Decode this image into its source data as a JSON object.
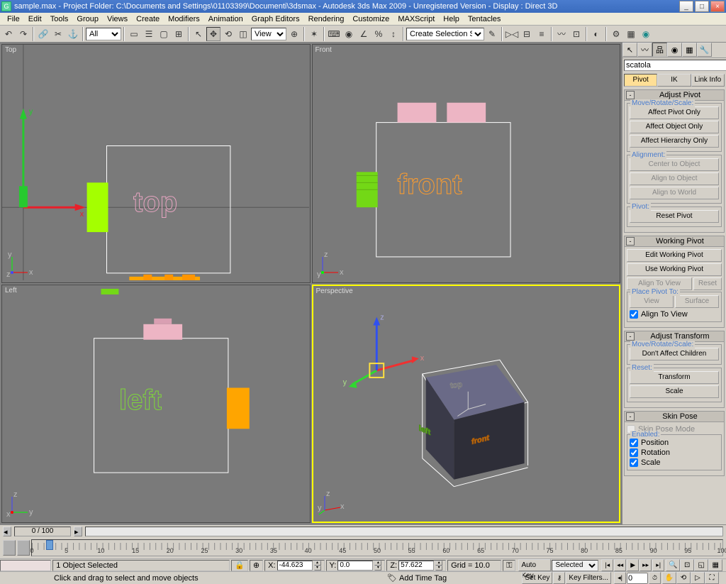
{
  "title": "sample.max    - Project Folder: C:\\Documents and Settings\\01103399\\Documenti\\3dsmax       - Autodesk 3ds Max  2009  - Unregistered Version      - Display : Direct 3D",
  "menu": [
    "File",
    "Edit",
    "Tools",
    "Group",
    "Views",
    "Create",
    "Modifiers",
    "Animation",
    "Graph Editors",
    "Rendering",
    "Customize",
    "MAXScript",
    "Help",
    "Tentacles"
  ],
  "toolbar": {
    "select_filter": "All",
    "ref_coord": "View",
    "named_sel": "Create Selection Set"
  },
  "viewports": {
    "top_left": "Top",
    "top_right": "Front",
    "bottom_left": "Left",
    "bottom_right": "Perspective",
    "text_top": "top",
    "text_front": "front",
    "text_left": "left"
  },
  "command_panel": {
    "object_name": "scatola",
    "subtabs": [
      "Pivot",
      "IK",
      "Link Info"
    ],
    "adjust_pivot": {
      "title": "Adjust Pivot",
      "move_rotate_scale": "Move/Rotate/Scale:",
      "affect_pivot_only": "Affect Pivot Only",
      "affect_object_only": "Affect Object Only",
      "affect_hierarchy_only": "Affect Hierarchy Only",
      "alignment": "Alignment:",
      "center_to_object": "Center to Object",
      "align_to_object": "Align to Object",
      "align_to_world": "Align to World",
      "pivot": "Pivot:",
      "reset_pivot": "Reset Pivot"
    },
    "working_pivot": {
      "title": "Working Pivot",
      "edit_wp": "Edit Working Pivot",
      "use_wp": "Use Working Pivot",
      "align_to_view": "Align To View",
      "reset": "Reset",
      "place_pivot_to": "Place Pivot To:",
      "view": "View",
      "surface": "Surface",
      "align_to_view_chk": "Align To View"
    },
    "adjust_transform": {
      "title": "Adjust Transform",
      "move_rotate_scale": "Move/Rotate/Scale:",
      "dont_affect_children": "Don't Affect Children",
      "reset": "Reset:",
      "transform": "Transform",
      "scale": "Scale"
    },
    "skin_pose": {
      "title": "Skin Pose",
      "skin_pose_mode": "Skin Pose Mode",
      "enabled": "Enabled:",
      "position": "Position",
      "rotation": "Rotation",
      "scale": "Scale"
    }
  },
  "track_bar": {
    "frame_label": "0 / 100"
  },
  "time_ticks": [
    "0",
    "5",
    "10",
    "15",
    "20",
    "25",
    "30",
    "35",
    "40",
    "45",
    "50",
    "55",
    "60",
    "65",
    "70",
    "75",
    "80",
    "85",
    "90",
    "95",
    "100"
  ],
  "status": {
    "selection": "1 Object Selected",
    "x": "-44.623",
    "y": "0.0",
    "z": "57.622",
    "grid": "Grid = 10.0",
    "prompt": "Click and drag to select and move objects",
    "add_time_tag": "Add Time Tag",
    "auto_key": "Auto Key",
    "set_key": "Set Key",
    "key_filters": "Key Filters...",
    "key_mode": "Selected"
  }
}
